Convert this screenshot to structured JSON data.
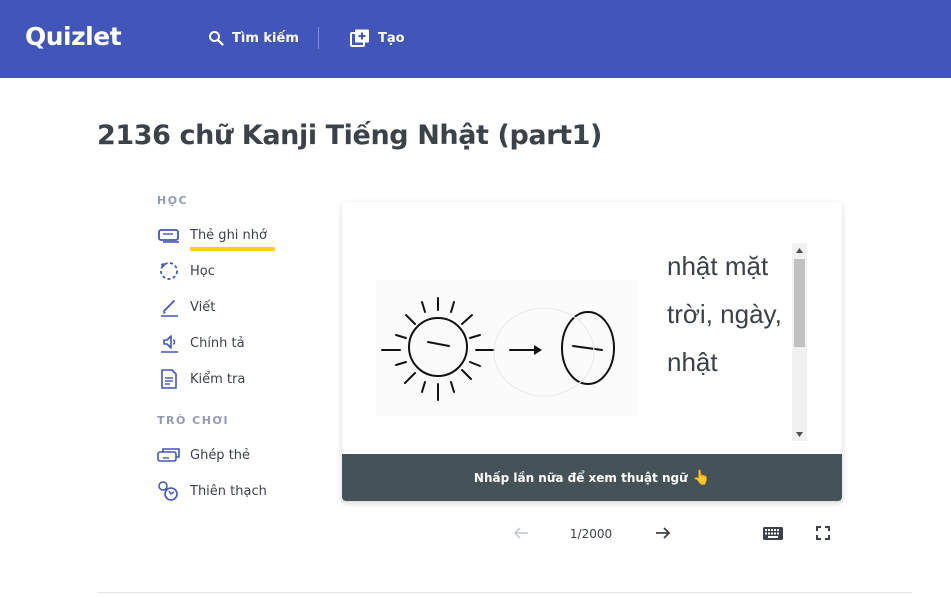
{
  "header": {
    "logo": "Quizlet",
    "search_label": "Tìm kiếm",
    "create_label": "Tạo"
  },
  "page_title": "2136 chữ Kanji Tiếng Nhật (part1)",
  "sidebar": {
    "study_heading": "HỌC",
    "study_modes": [
      {
        "label": "Thẻ ghi nhớ",
        "icon": "flashcards-icon",
        "active": true
      },
      {
        "label": "Học",
        "icon": "learn-icon"
      },
      {
        "label": "Viết",
        "icon": "write-icon"
      },
      {
        "label": "Chính tả",
        "icon": "spell-icon"
      },
      {
        "label": "Kiểm tra",
        "icon": "test-icon"
      }
    ],
    "games_heading": "TRÒ CHƠI",
    "game_modes": [
      {
        "label": "Ghép thẻ",
        "icon": "match-icon"
      },
      {
        "label": "Thiên thạch",
        "icon": "gravity-icon"
      }
    ]
  },
  "flashcard": {
    "definition": "nhật mặt trời, ngày, nhật",
    "footer_text": "Nhấp lần nữa để xem thuật ngữ",
    "footer_emoji": "👆",
    "image_icon": "sun-to-kanji-illustration"
  },
  "controls": {
    "counter": "1/2000",
    "prev_icon": "arrow-left-icon",
    "next_icon": "arrow-right-icon",
    "keyboard_icon": "keyboard-icon",
    "fullscreen_icon": "fullscreen-icon"
  },
  "colors": {
    "brand": "#4255b8",
    "accent_underline": "#ffcd1f",
    "footer": "#455358"
  }
}
